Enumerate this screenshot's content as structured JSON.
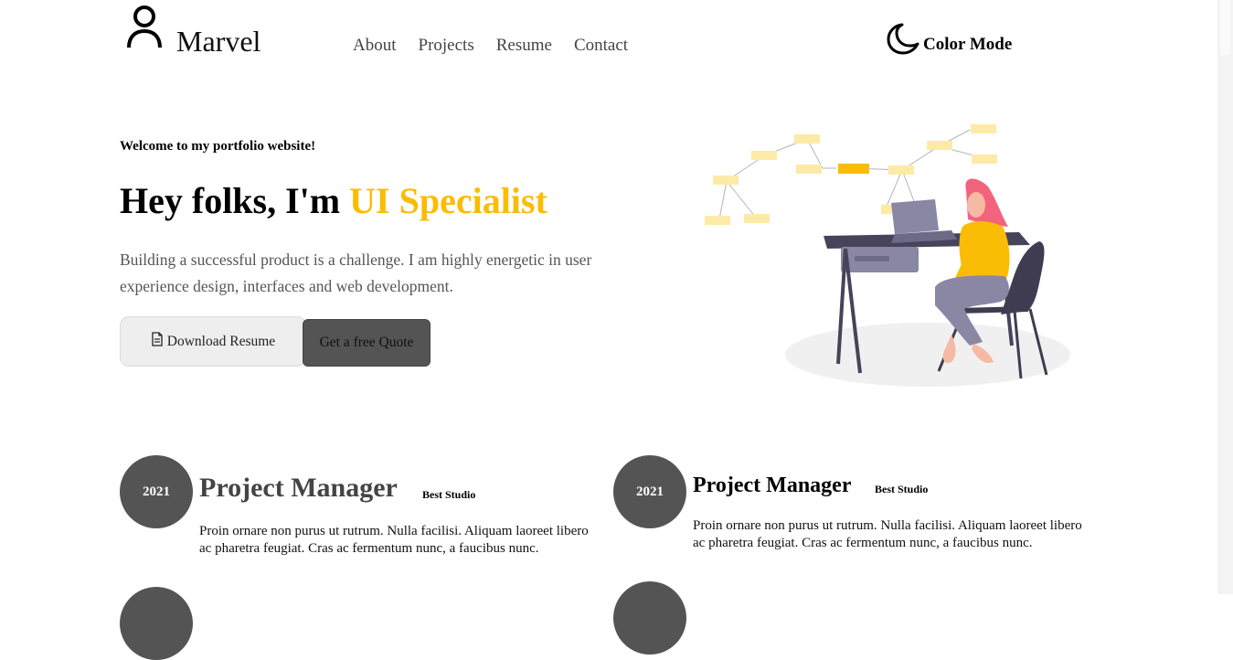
{
  "header": {
    "logo_text": "Marvel",
    "nav": [
      "About",
      "Projects",
      "Resume",
      "Contact"
    ],
    "color_mode_label": "Color Mode"
  },
  "hero": {
    "welcome": "Welcome to my portfolio website!",
    "headline_prefix": "Hey folks, I'm ",
    "headline_accent": "UI Specialist",
    "intro": "Building a successful product is a challenge. I am highly energetic in user experience design, interfaces and web development.",
    "download_label": "Download Resume",
    "quote_label": "Get a free Quote"
  },
  "experience": [
    {
      "year": "2021",
      "title": "Project Manager",
      "company": "Best Studio",
      "description": "Proin ornare non purus ut rutrum. Nulla facilisi. Aliquam laoreet libero ac pharetra feugiat. Cras ac fermentum nunc, a faucibus nunc."
    },
    {
      "year": "2021",
      "title": "Project Manager",
      "company": "Best Studio",
      "description": "Proin ornare non purus ut rutrum. Nulla facilisi. Aliquam laoreet libero ac pharetra feugiat. Cras ac fermentum nunc, a faucibus nunc."
    }
  ],
  "colors": {
    "accent": "#fbbc05",
    "badge": "#545454",
    "desk": "#46435a",
    "hair": "#f2637d",
    "shirt": "#fbbc05",
    "pants": "#8a87a4",
    "note": "#fdeaa7"
  },
  "icons": {
    "logo": "user-icon",
    "color_mode": "moon-icon",
    "download": "document-icon"
  }
}
